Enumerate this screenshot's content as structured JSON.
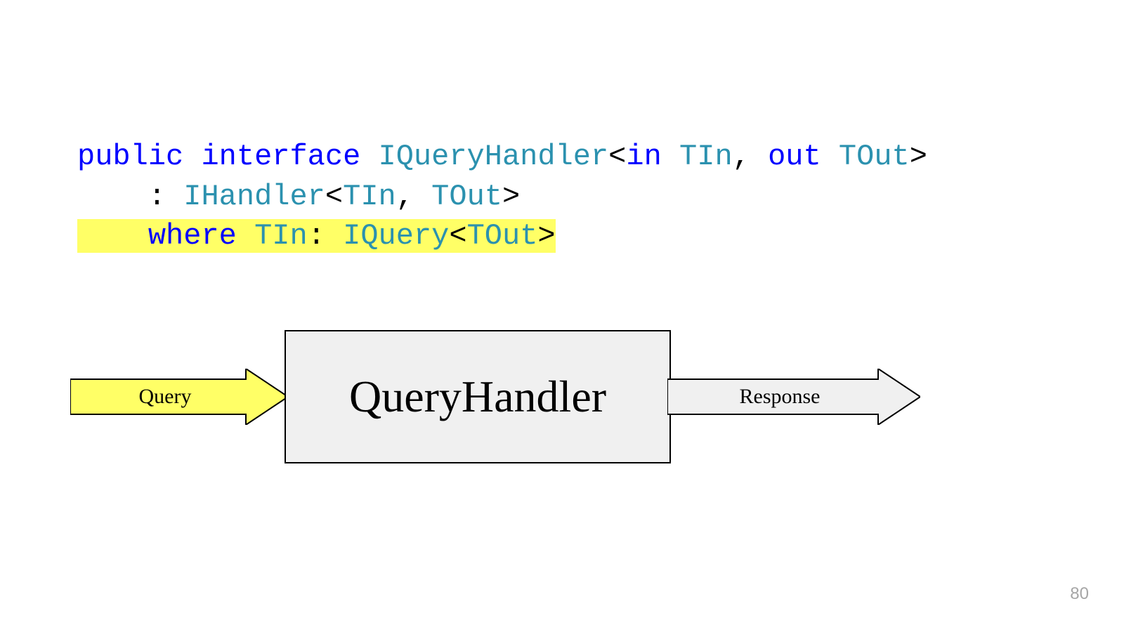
{
  "code": {
    "kw_public": "public",
    "kw_interface": "interface",
    "type_iqh": "IQueryHandler",
    "lt": "<",
    "gt": ">",
    "kw_in": "in",
    "sp": " ",
    "tin": "TIn",
    "comma": ", ",
    "kw_out": "out",
    "tout": "TOut",
    "indent": "    ",
    "colon_sp": ": ",
    "type_ihandler": "IHandler",
    "kw_where": "where",
    "type_iquery": "IQuery"
  },
  "diagram": {
    "query": "Query",
    "handler": "QueryHandler",
    "response": "Response"
  },
  "page_number": "80",
  "colors": {
    "keyword": "#0000ff",
    "type": "#2b91af",
    "highlight": "#ffff66",
    "arrow_query_fill": "#ffff66",
    "arrow_response_fill": "#f0f0f0",
    "box_fill": "#f0f0f0"
  }
}
